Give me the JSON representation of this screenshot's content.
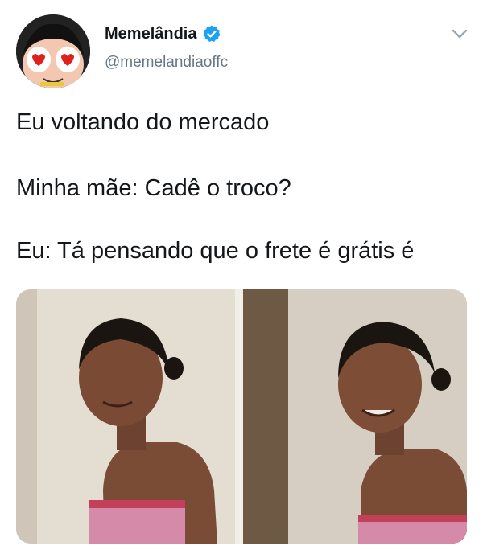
{
  "tweet": {
    "display_name": "Memelândia",
    "handle": "@memelandiaoffc",
    "lines": [
      "Eu voltando do mercado",
      "Minha mãe: Cadê o troco?",
      "Eu: Tá pensando que o frete é grátis é"
    ]
  },
  "icons": {
    "avatar": "cartoon-face-heart-eyes-avatar",
    "verified": "verified-badge-icon",
    "menu": "chevron-down-icon"
  },
  "colors": {
    "verified": "#1da1f2",
    "handle": "#657786",
    "text": "#14171a"
  }
}
